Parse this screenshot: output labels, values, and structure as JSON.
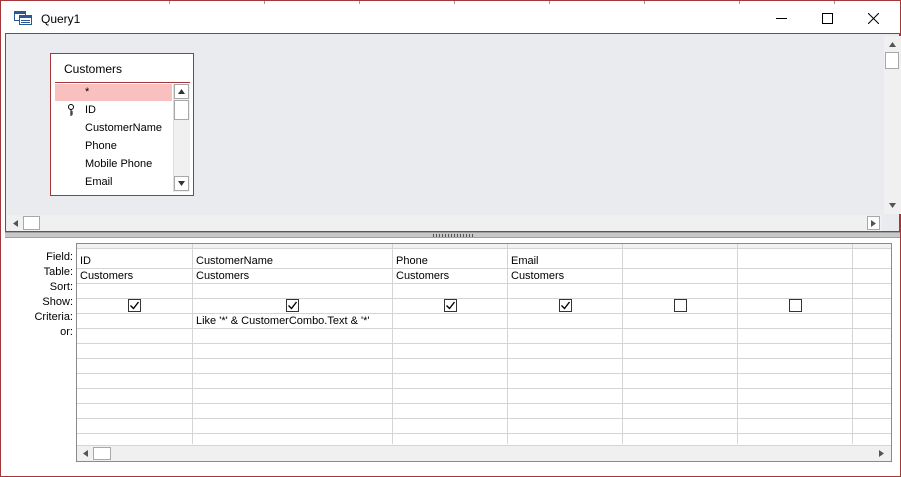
{
  "window": {
    "title": "Query1"
  },
  "design": {
    "table": {
      "name": "Customers",
      "fields": [
        "*",
        "ID",
        "CustomerName",
        "Phone",
        "Mobile Phone",
        "Email"
      ]
    }
  },
  "grid": {
    "row_labels": {
      "field": "Field:",
      "table": "Table:",
      "sort": "Sort:",
      "show": "Show:",
      "criteria": "Criteria:",
      "or": "or:"
    },
    "columns": [
      {
        "field": "ID",
        "table": "Customers",
        "sort": "",
        "show": true,
        "criteria": ""
      },
      {
        "field": "CustomerName",
        "table": "Customers",
        "sort": "",
        "show": true,
        "criteria": "Like '*' & CustomerCombo.Text & '*'"
      },
      {
        "field": "Phone",
        "table": "Customers",
        "sort": "",
        "show": true,
        "criteria": ""
      },
      {
        "field": "Email",
        "table": "Customers",
        "sort": "",
        "show": true,
        "criteria": ""
      },
      {
        "field": "",
        "table": "",
        "sort": "",
        "show": false,
        "criteria": ""
      },
      {
        "field": "",
        "table": "",
        "sort": "",
        "show": false,
        "criteria": ""
      },
      {
        "field": "",
        "table": "",
        "sort": "",
        "show": false,
        "criteria": ""
      }
    ]
  },
  "colors": {
    "accent": "#a4373a",
    "selected_row": "#f9c0c0",
    "design_bg": "#eaebee"
  }
}
